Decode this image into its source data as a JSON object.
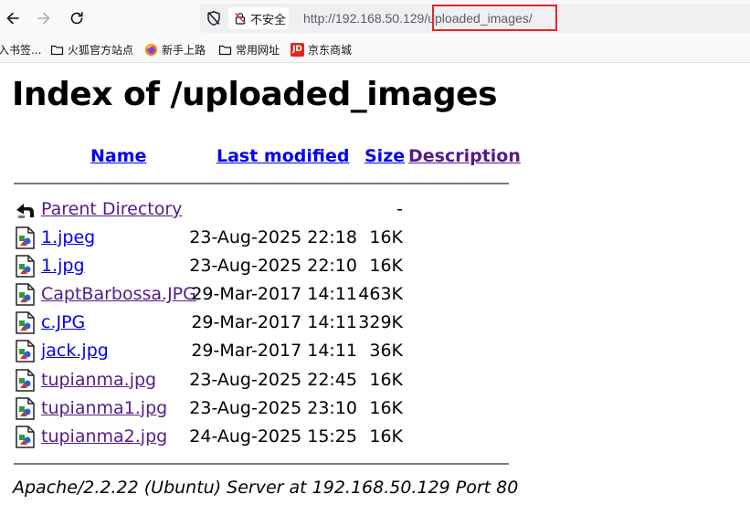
{
  "browser": {
    "security_label": "不安全",
    "url_host": "http://192.168.50.129",
    "url_path": "/uploaded_images/",
    "bookmarks": [
      {
        "label": "入书签..."
      },
      {
        "label": "火狐官方站点"
      },
      {
        "label": "新手上路"
      },
      {
        "label": "常用网址"
      },
      {
        "label": "京东商城",
        "badge": "JD"
      }
    ]
  },
  "page": {
    "title": "Index of /uploaded_images",
    "columns": {
      "name": "Name",
      "modified": "Last modified",
      "size": "Size",
      "description": "Description"
    },
    "parent": {
      "name": "Parent Directory",
      "size": "-"
    },
    "files": [
      {
        "name": "1.jpeg",
        "modified": "23-Aug-2025 22:18",
        "size": "16K",
        "visited": false
      },
      {
        "name": "1.jpg",
        "modified": "23-Aug-2025 22:10",
        "size": "16K",
        "visited": false
      },
      {
        "name": "CaptBarbossa.JPG",
        "modified": "29-Mar-2017 14:11",
        "size": "463K",
        "visited": true
      },
      {
        "name": "c.JPG",
        "modified": "29-Mar-2017 14:11",
        "size": "329K",
        "visited": false
      },
      {
        "name": "jack.jpg",
        "modified": "29-Mar-2017 14:11",
        "size": "36K",
        "visited": false
      },
      {
        "name": "tupianma.jpg",
        "modified": "23-Aug-2025 22:45",
        "size": "16K",
        "visited": true
      },
      {
        "name": "tupianma1.jpg",
        "modified": "23-Aug-2025 23:10",
        "size": "16K",
        "visited": true
      },
      {
        "name": "tupianma2.jpg",
        "modified": "24-Aug-2025 15:25",
        "size": "16K",
        "visited": true
      }
    ],
    "footer": "Apache/2.2.22 (Ubuntu) Server at 192.168.50.129 Port 80"
  },
  "colors": {
    "link": "#0000ee",
    "visited": "#551a8b",
    "highlight": "#e0282c"
  }
}
